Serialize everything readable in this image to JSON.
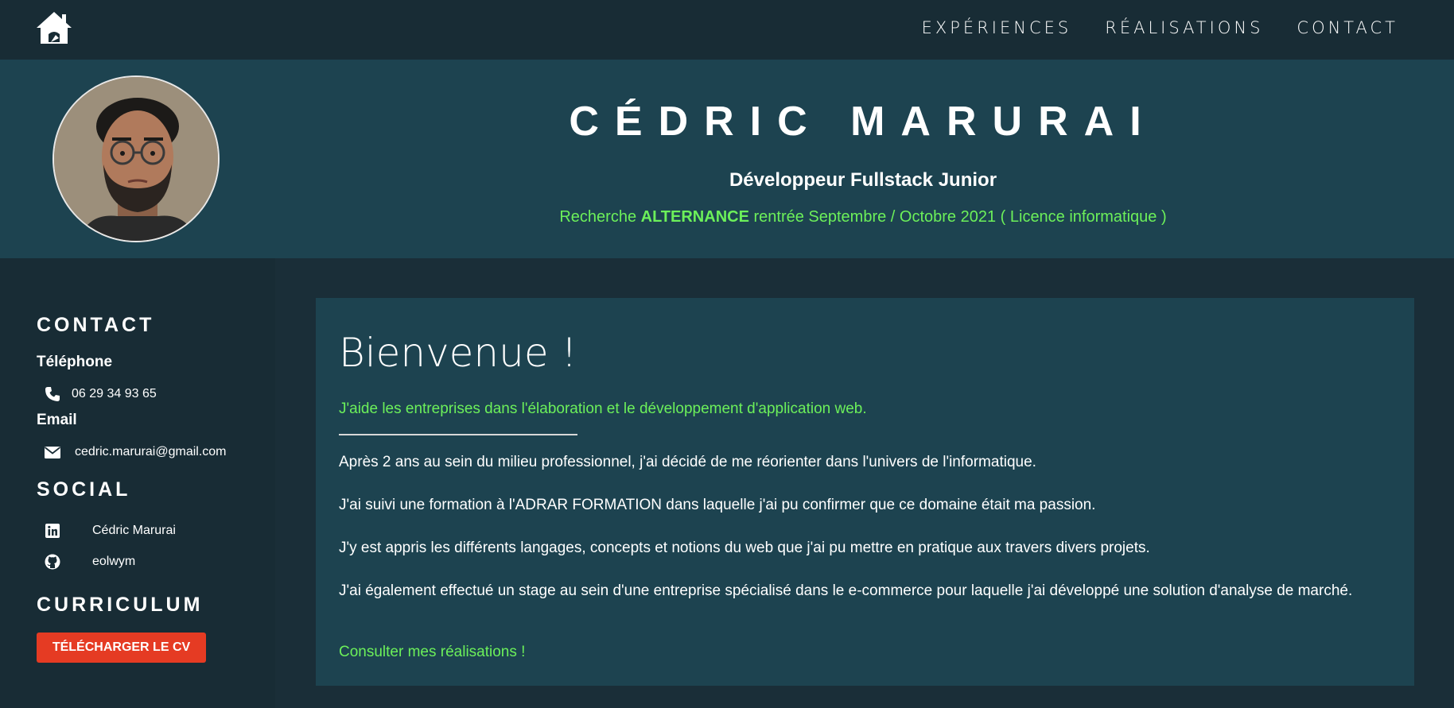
{
  "nav": {
    "home_icon": "home-icon",
    "links": [
      "EXPÉRIENCES",
      "RÉALISATIONS",
      "CONTACT"
    ]
  },
  "header": {
    "name": "CÉDRIC MARURAI",
    "job_title": "Développeur Fullstack Junior",
    "search_prefix": "Recherche ",
    "search_highlight": "ALTERNANCE",
    "search_suffix": " rentrée Septembre / Octobre 2021 ( Licence informatique )"
  },
  "sidebar": {
    "contact_title": "CONTACT",
    "phone_label": "Téléphone",
    "phone": "06 29 34 93 65",
    "email_label": "Email",
    "email": "cedric.marurai@gmail.com",
    "social_title": "SOCIAL",
    "linkedin": "Cédric Marurai",
    "github": "eolwym",
    "curriculum_title": "CURRICULUM",
    "cv_button": "TÉLÉCHARGER LE CV"
  },
  "main": {
    "welcome": "Bienvenue !",
    "tagline": "J'aide les entreprises dans l'élaboration et le développement d'application web.",
    "paragraphs": [
      "Après 2 ans au sein du milieu professionnel, j'ai décidé de me réorienter dans l'univers de l'informatique.",
      "J'ai suivi une formation à l'ADRAR FORMATION dans laquelle j'ai pu confirmer que ce domaine était ma passion.",
      "J'y est appris les différents langages, concepts et notions du web que j'ai pu mettre en pratique aux travers divers projets.",
      "J'ai également effectué un stage au sein d'une entreprise spécialisé dans le e-commerce pour laquelle j'ai développé une solution d'analyse de marché."
    ],
    "cta": "Consulter mes réalisations !"
  },
  "colors": {
    "accent_green": "#6cf05a",
    "button_red": "#e53b23",
    "header_bg": "#1d4350",
    "dark_bg": "#182c35"
  }
}
